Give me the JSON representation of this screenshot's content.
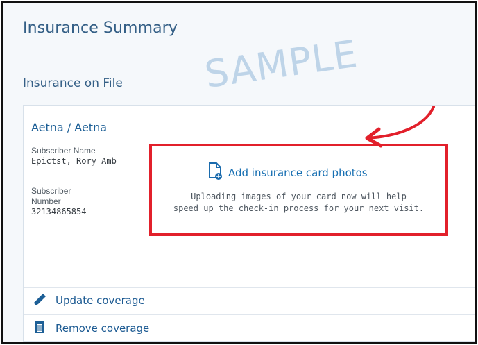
{
  "page": {
    "title": "Insurance Summary",
    "section_title": "Insurance on File",
    "watermark": "SAMPLE"
  },
  "coverage_card": {
    "payer": "Aetna / Aetna",
    "subscriber_name_label": "Subscriber Name",
    "subscriber_name": "Epictst, Rory Amb",
    "subscriber_number_label_line1": "Subscriber",
    "subscriber_number_label_line2": "Number",
    "subscriber_number": "32134865854"
  },
  "add_photos": {
    "label": "Add insurance card photos",
    "help_line1": "Uploading images of your card now will help",
    "help_line2": "speed up the check-in process for your next visit."
  },
  "actions": {
    "update_label": "Update coverage",
    "remove_label": "Remove coverage"
  },
  "colors": {
    "accent": "#1d5f96",
    "highlight": "#e2202b",
    "watermark": "#a9c7e2"
  },
  "icons": {
    "add_photo": "document-plus-icon",
    "update": "pencil-icon",
    "remove": "trash-icon"
  }
}
